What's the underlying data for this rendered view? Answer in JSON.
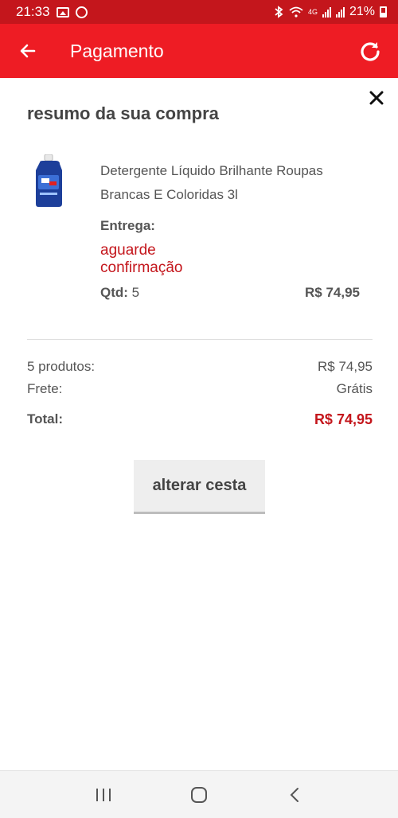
{
  "status_bar": {
    "time": "21:33",
    "network": "4G",
    "battery": "21%"
  },
  "app_bar": {
    "title": "Pagamento",
    "back_icon": "arrow-left-icon",
    "refresh_icon": "refresh-icon",
    "color": "#ee1c24"
  },
  "summary": {
    "title": "resumo da sua compra",
    "close_icon": "close-icon",
    "product": {
      "name": "Detergente Líquido Brilhante Roupas Brancas E Coloridas 3l",
      "delivery_label": "Entrega:",
      "delivery_status": "aguarde confirmação",
      "qty_label": "Qtd:",
      "qty_value": "5",
      "price": "R$ 74,95"
    },
    "products_label": "5 produtos:",
    "products_value": "R$ 74,95",
    "freight_label": "Frete:",
    "freight_value": "Grátis",
    "total_label": "Total:",
    "total_value": "R$ 74,95",
    "accent_color": "#c4161c",
    "alter_button": "alterar cesta"
  },
  "nav_bar": {
    "recents_icon": "recent-apps-icon",
    "home_icon": "home-icon",
    "back_icon": "back-icon"
  }
}
